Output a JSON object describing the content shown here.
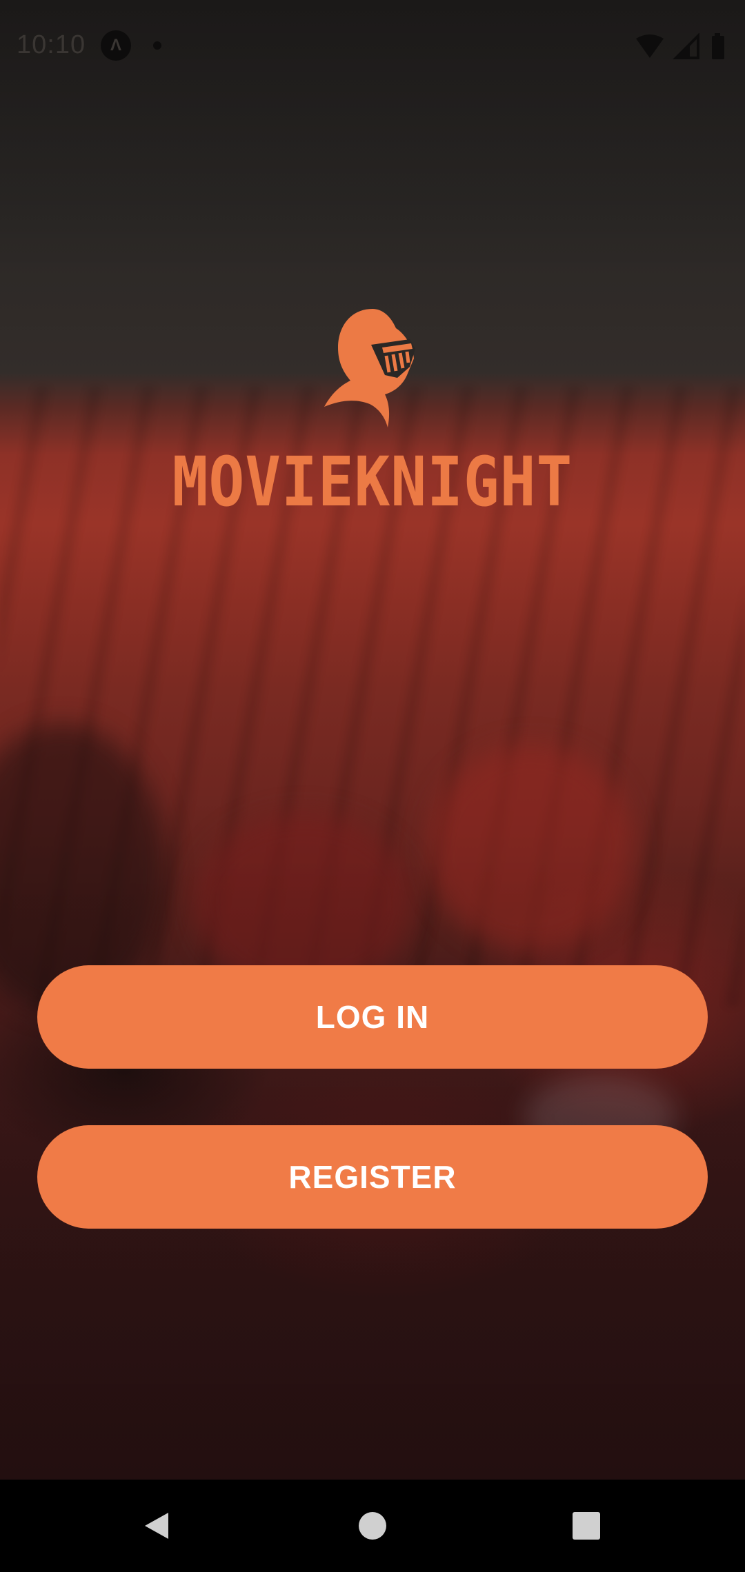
{
  "status_bar": {
    "time": "10:10",
    "app_icon": "expo-icon",
    "notification_dot": "dot-icon",
    "icons": [
      "wifi-icon",
      "signal-icon",
      "battery-icon"
    ]
  },
  "brand": {
    "logo_icon": "knight-helmet-icon",
    "name": "MOVIEKNIGHT",
    "color": "#ec7a45"
  },
  "actions": {
    "login_label": "LOG IN",
    "register_label": "REGISTER",
    "button_color": "#f07b47"
  },
  "nav_bar": {
    "icons": [
      "back-icon",
      "home-icon",
      "recents-icon"
    ]
  }
}
